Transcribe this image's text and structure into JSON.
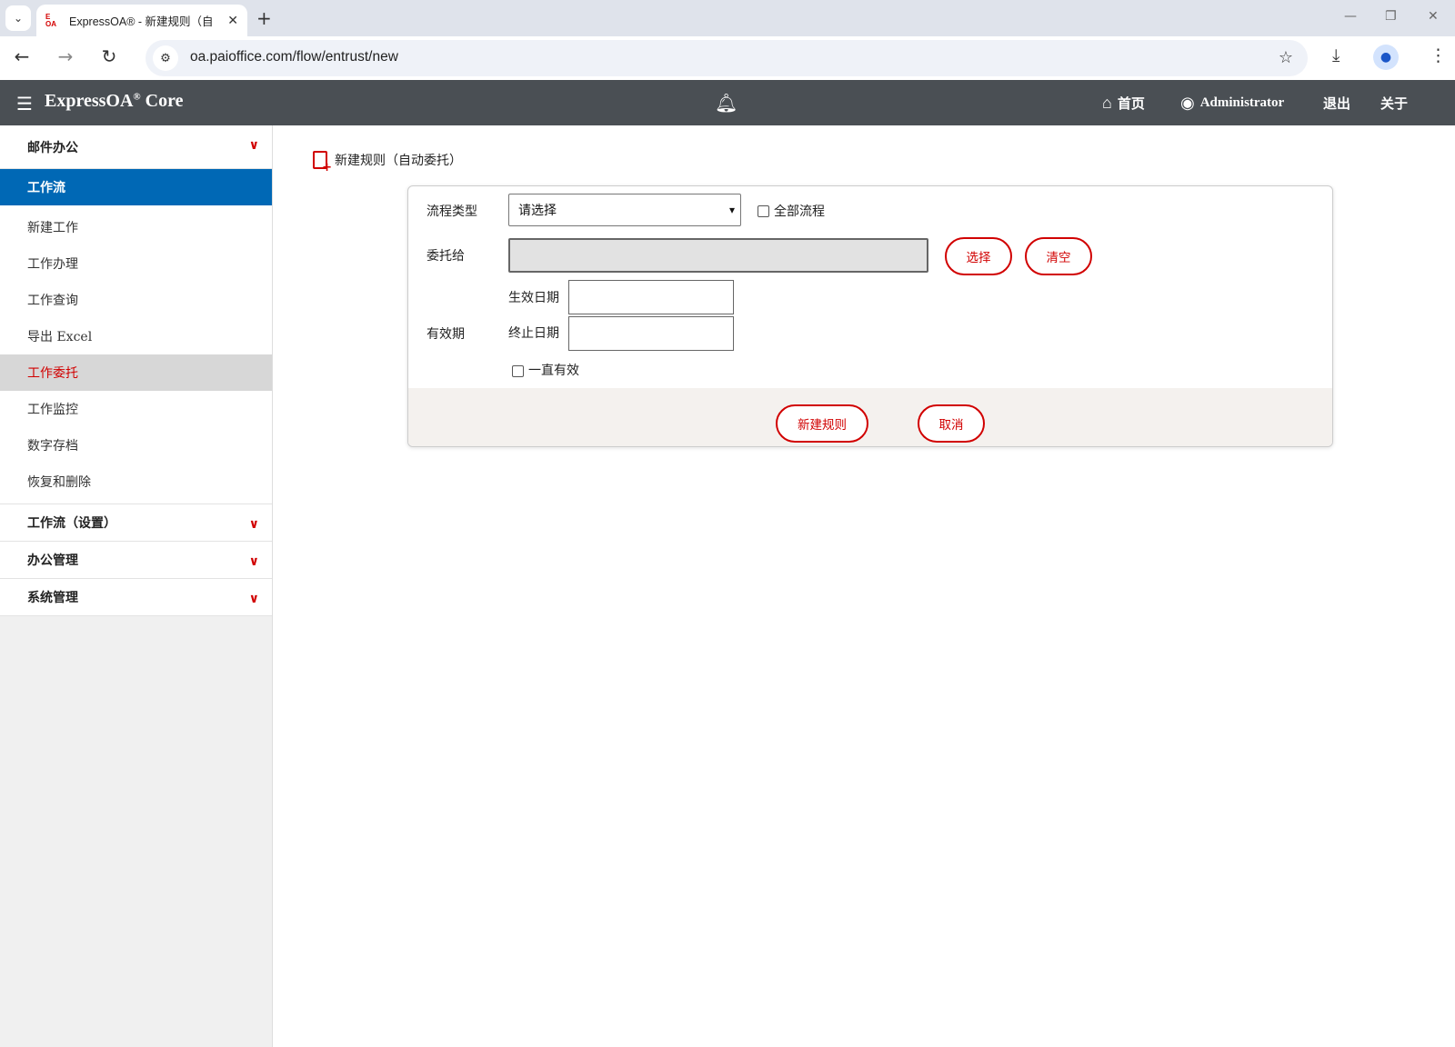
{
  "browser": {
    "tab_favicon": "E OA",
    "tab_title": "ExpressOA® - 新建规则（自",
    "url": "oa.paioffice.com/flow/entrust/new"
  },
  "appbar": {
    "brand": "ExpressOA",
    "brand_mark": "®",
    "brand_suffix": "Core",
    "home": "首页",
    "user": "Administrator",
    "logout": "退出",
    "about": "关于"
  },
  "sidebar": {
    "mail": "邮件办公",
    "workflow": "工作流",
    "items": [
      "新建工作",
      "工作办理",
      "工作查询",
      "导出 Excel",
      "工作委托",
      "工作监控",
      "数字存档",
      "恢复和删除"
    ],
    "current_index": 4,
    "workflow_settings": "工作流（设置）",
    "office_mgmt": "办公管理",
    "system_mgmt": "系统管理"
  },
  "form": {
    "title": "新建规则（自动委托）",
    "flow_type_label": "流程类型",
    "flow_type_value": "请选择",
    "all_flows_label": "全部流程",
    "entrust_to_label": "委托给",
    "select_button": "选择",
    "clear_button": "清空",
    "validity_label": "有效期",
    "start_date_label": "生效日期",
    "end_date_label": "终止日期",
    "always_valid_label": "一直有效",
    "submit_button": "新建规则",
    "cancel_button": "取消"
  },
  "colors": {
    "accent_red": "#d10000",
    "active_blue": "#0068b5",
    "header_gray": "#4a4f54"
  }
}
